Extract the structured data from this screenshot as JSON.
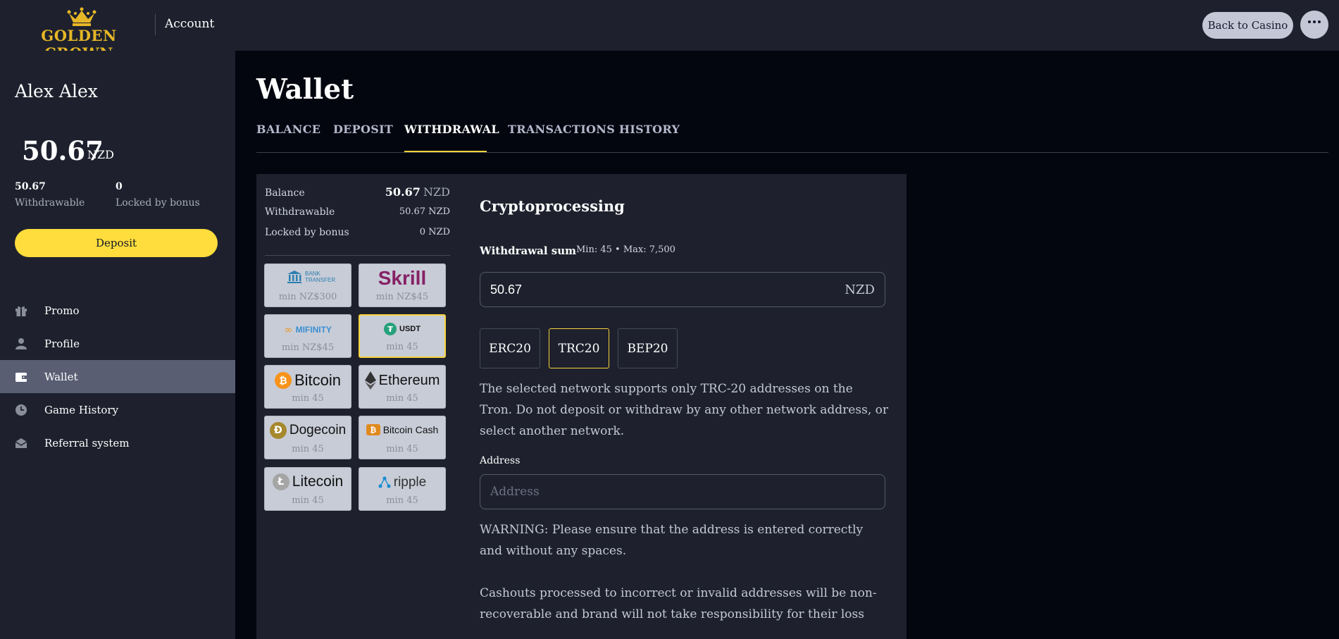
{
  "brand": {
    "logo_text": "GOLDEN CROWN",
    "color": "#e6b727"
  },
  "header": {
    "title": "Account",
    "back_label": "Back to Casino",
    "more_icon": "more-dots-icon"
  },
  "sidebar": {
    "user_name": "Alex Alex",
    "balance": "50.67",
    "currency": "NZD",
    "withdrawable_value": "50.67",
    "withdrawable_label": "Withdrawable",
    "locked_value": "0",
    "locked_label": "Locked by bonus",
    "deposit_label": "Deposit",
    "nav": [
      {
        "label": "Promo",
        "icon": "gift-icon"
      },
      {
        "label": "Profile",
        "icon": "user-icon"
      },
      {
        "label": "Wallet",
        "icon": "wallet-icon",
        "active": true
      },
      {
        "label": "Game History",
        "icon": "clock-icon"
      },
      {
        "label": "Referral system",
        "icon": "envelope-icon"
      }
    ]
  },
  "main": {
    "title": "Wallet",
    "tabs": [
      {
        "label": "BALANCE"
      },
      {
        "label": "DEPOSIT"
      },
      {
        "label": "WITHDRAWAL",
        "active": true
      },
      {
        "label": "TRANSACTIONS HISTORY"
      }
    ],
    "summary": {
      "balance_label": "Balance",
      "balance_value": "50.67",
      "balance_currency": "NZD",
      "withdrawable_label": "Withdrawable",
      "withdrawable_value": "50.67 NZD",
      "locked_label": "Locked by bonus",
      "locked_value": "0 NZD"
    },
    "methods": [
      {
        "name": "BANK TRANSFER",
        "min": "min NZ$300"
      },
      {
        "name": "Skrill",
        "min": "min NZ$45"
      },
      {
        "name": "MIFINITY",
        "min": "min NZ$45"
      },
      {
        "name": "USDT",
        "min": "min 45",
        "active": true
      },
      {
        "name": "Bitcoin",
        "min": "min 45"
      },
      {
        "name": "Ethereum",
        "min": "min 45"
      },
      {
        "name": "Dogecoin",
        "min": "min 45"
      },
      {
        "name": "Bitcoin Cash",
        "min": "min 45"
      },
      {
        "name": "Litecoin",
        "min": "min 45"
      },
      {
        "name": "ripple",
        "min": "min 45"
      }
    ],
    "form": {
      "title": "Cryptoprocessing",
      "sum_label": "Withdrawal sum",
      "sum_hint": "Min: 45 • Max: 7,500",
      "amount_value": "50.67",
      "amount_currency": "NZD",
      "networks": [
        {
          "label": "ERC20"
        },
        {
          "label": "TRC20",
          "active": true
        },
        {
          "label": "BEP20"
        }
      ],
      "network_note": "The selected network supports only TRC-20 addresses on the Tron. Do not deposit or withdraw by any other network address, or select another network.",
      "address_label": "Address",
      "address_placeholder": "Address",
      "address_value": "",
      "warning": "WARNING: Please ensure that the address is entered correctly and without any spaces.",
      "loss_note": "Cashouts processed to incorrect or invalid addresses will be non-recoverable and brand will not take responsibility for their loss"
    }
  }
}
